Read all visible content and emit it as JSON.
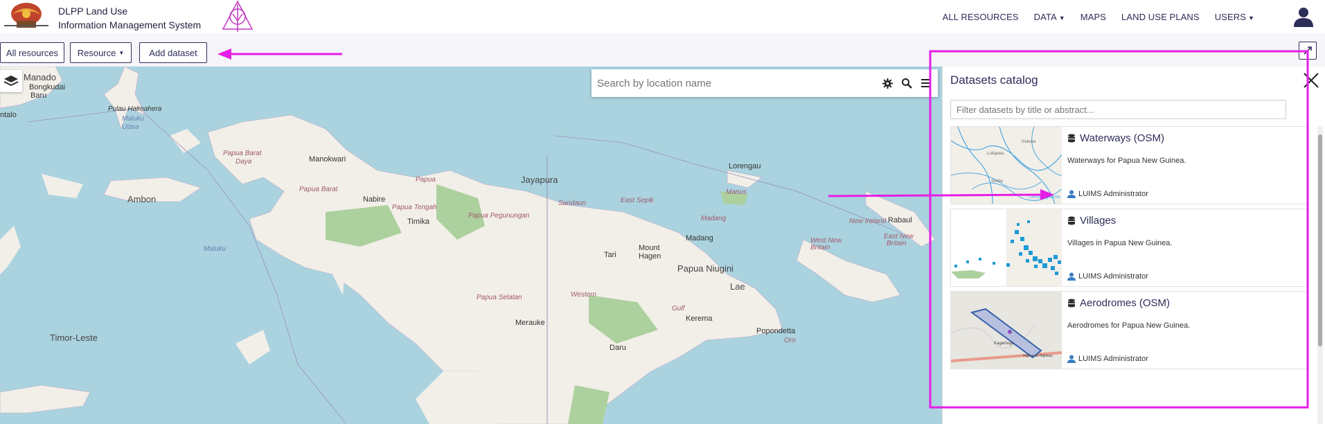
{
  "header": {
    "brand_line1": "DLPP Land Use",
    "brand_line2": "Information Management System",
    "nav": [
      "ALL RESOURCES",
      "DATA",
      "MAPS",
      "LAND USE PLANS",
      "USERS"
    ]
  },
  "toolbar": {
    "all_resources": "All resources",
    "resource": "Resource",
    "add_dataset": "Add dataset"
  },
  "map": {
    "search_placeholder": "Search by location name",
    "places": {
      "manado": "Manado",
      "bongkudai": "Bongkudai",
      "baru": "Baru",
      "ntalo": "ntalo",
      "halmahera": "Pulau Halmahera",
      "maluku_utara": "Maluku",
      "utara": "Utara",
      "papua_barat": "Papua Barat",
      "daya": "Daya",
      "manokwari": "Manokwari",
      "papua": "Papua",
      "papua_barat2": "Papua Barat",
      "lorengau": "Lorengau",
      "manus": "Manus",
      "new_ireland": "New Ireland",
      "ambon": "Ambon",
      "jayapura": "Jayapura",
      "sandaun": "Sandaun",
      "east_sepik": "East Sepik",
      "nabire": "Nabire",
      "papua_tengah": "Papua Tengah",
      "papua_pegunungan": "Papua Pegunungan",
      "timika": "Timika",
      "madang_prov": "Madang",
      "madang": "Madang",
      "maluku": "Maluku",
      "mount_hagen": "Mount",
      "hagen": "Hagen",
      "tari": "Tari",
      "papua_niugini": "Papua Niugini",
      "west_new_britain": "West New",
      "britain": "Britain",
      "east_new_britain": "East New",
      "britain2": "Britain",
      "rabaul": "Rabaul",
      "lae": "Lae",
      "papua_selatan": "Papua Selatan",
      "western": "Western",
      "gulf": "Gulf",
      "kerema": "Kerema",
      "merauke": "Merauke",
      "popondetta": "Popondetta",
      "oro": "Oro",
      "timor_leste": "Timor-Leste",
      "daru": "Daru"
    }
  },
  "catalog": {
    "title": "Datasets catalog",
    "filter_placeholder": "Filter datasets by title or abstract...",
    "datasets": [
      {
        "title": "Waterways (OSM)",
        "description": "Waterways for Papua New Guinea.",
        "author": "LUIMS Administrator"
      },
      {
        "title": "Villages",
        "description": "Villages in Papua New Guinea.",
        "author": "LUIMS Administrator"
      },
      {
        "title": "Aerodromes (OSM)",
        "description": "Aerodromes for Papua New Guinea.",
        "author": "LUIMS Administrator"
      }
    ],
    "thumb_labels": {
      "w1": "Lufojawa",
      "w2": "Gukske",
      "w3": "Simbo",
      "w4": "Lavusi Highlands",
      "a1": "Kagamuga",
      "a2": "Highlands Highway"
    }
  },
  "colors": {
    "primary": "#2d2d5a",
    "annotation": "#e51ee5",
    "water": "#aad3df",
    "land": "#f2efe9"
  }
}
